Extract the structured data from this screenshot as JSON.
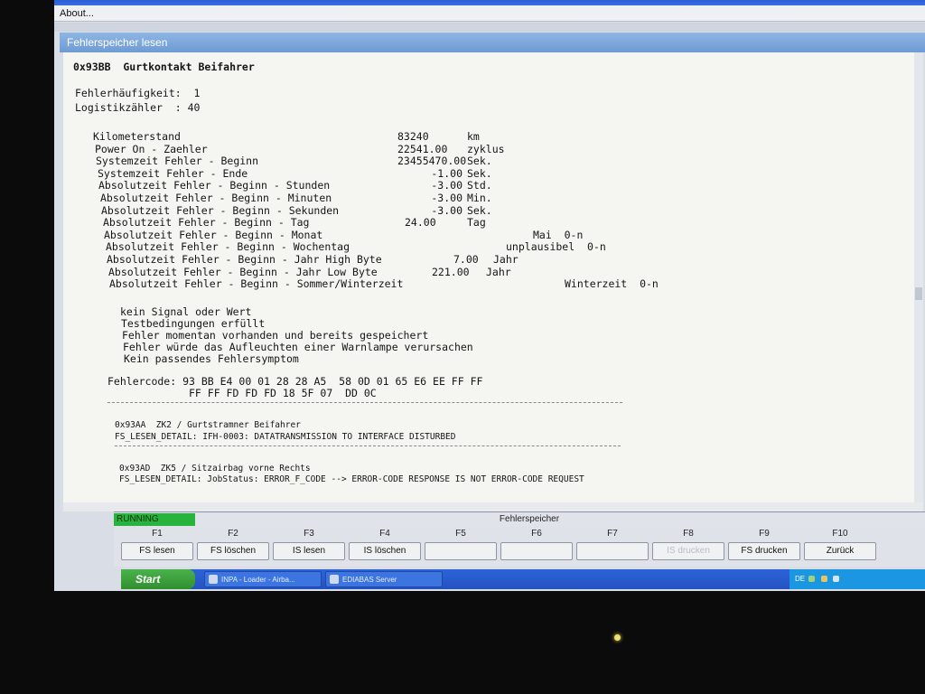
{
  "app": {
    "menu_item": "About...",
    "window_title": "Fehlerspeicher lesen"
  },
  "report": {
    "fault1": {
      "header": "0x93BB  Gurtkontakt Beifahrer",
      "haeufigkeit": "Fehlerhäufigkeit:  1",
      "logistik": "Logistikzähler  : 40",
      "env_rows": [
        {
          "label": "Kilometerstand",
          "value": "83240",
          "unit": "km"
        },
        {
          "label": "Power On - Zaehler",
          "value": "22541.00",
          "unit": "zyklus"
        },
        {
          "label": "Systemzeit Fehler - Beginn",
          "value": "23455470.00",
          "unit": "Sek."
        },
        {
          "label": "Systemzeit Fehler - Ende",
          "value": "-1.00",
          "unit": "Sek."
        },
        {
          "label": "Absolutzeit Fehler - Beginn - Stunden",
          "value": "-3.00",
          "unit": "Std."
        },
        {
          "label": "Absolutzeit Fehler - Beginn - Minuten",
          "value": "-3.00",
          "unit": "Min."
        },
        {
          "label": "Absolutzeit Fehler - Beginn - Sekunden",
          "value": "-3.00",
          "unit": "Sek."
        },
        {
          "label": "Absolutzeit Fehler - Beginn - Tag",
          "value": "24.00",
          "unit": "Tag"
        },
        {
          "label": "Absolutzeit Fehler - Beginn - Monat",
          "value": "Mai  0-n",
          "unit": ""
        },
        {
          "label": "Absolutzeit Fehler - Beginn - Wochentag",
          "value": "unplausibel  0-n",
          "unit": ""
        },
        {
          "label": "Absolutzeit Fehler - Beginn - Jahr High Byte",
          "value": "7.00",
          "unit": "Jahr"
        },
        {
          "label": "Absolutzeit Fehler - Beginn - Jahr Low Byte",
          "value": "221.00",
          "unit": "Jahr"
        },
        {
          "label": "Absolutzeit Fehler - Beginn - Sommer/Winterzeit",
          "value": "Winterzeit  0-n",
          "unit": ""
        }
      ],
      "status_lines": [
        "kein Signal oder Wert",
        "Testbedingungen erfüllt",
        "Fehler momentan vorhanden und bereits gespeichert",
        "Fehler würde das Aufleuchten einer Warnlampe verursachen",
        "Kein passendes Fehlersymptom"
      ],
      "fehlercode_line1": "Fehlercode: 93 BB E4 00 01 28 28 A5  58 0D 01 65 E6 EE FF FF",
      "fehlercode_line2": "FF FF FD FD FD 18 5F 07  DD 0C"
    },
    "fault2": {
      "header": "0x93AA  ZK2 / Gurtstramner Beifahrer",
      "detail": "FS_LESEN_DETAIL: IFH-0003: DATATRANSMISSION TO INTERFACE DISTURBED"
    },
    "fault3": {
      "header": "0x93AD  ZK5 / Sitzairbag vorne Rechts",
      "detail": "FS_LESEN_DETAIL: JobStatus: ERROR_F_CODE --> ERROR-CODE RESPONSE IS NOT ERROR-CODE REQUEST"
    }
  },
  "statusbar": {
    "running": "RUNNING",
    "title": "Fehlerspeicher"
  },
  "fkeys": [
    {
      "key": "F1",
      "label": "FS lesen",
      "enabled": true
    },
    {
      "key": "F2",
      "label": "FS löschen",
      "enabled": true
    },
    {
      "key": "F3",
      "label": "IS lesen",
      "enabled": true
    },
    {
      "key": "F4",
      "label": "IS löschen",
      "enabled": true
    },
    {
      "key": "F5",
      "label": "",
      "enabled": false
    },
    {
      "key": "F6",
      "label": "",
      "enabled": false
    },
    {
      "key": "F7",
      "label": "",
      "enabled": false
    },
    {
      "key": "F8",
      "label": "IS drucken",
      "enabled": false
    },
    {
      "key": "F9",
      "label": "FS drucken",
      "enabled": true
    },
    {
      "key": "F10",
      "label": "Zurück",
      "enabled": true
    }
  ],
  "taskbar": {
    "start": "Start",
    "items": [
      "INPA - Loader - Airba...",
      "EDIABAS Server"
    ],
    "tray_text": "DE"
  }
}
